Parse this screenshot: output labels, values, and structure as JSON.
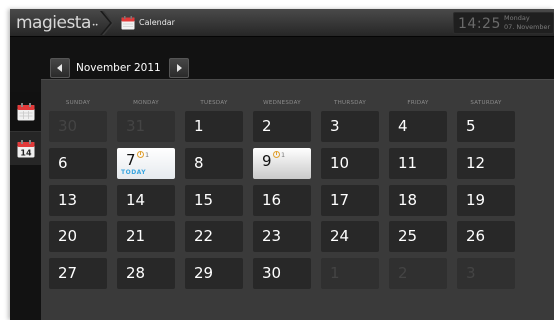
{
  "app": {
    "brand": "magiesta",
    "brand_mark": "••",
    "title": "Calendar",
    "accent_color": "#e23a3a",
    "today_color": "#3aa6e0"
  },
  "clock": {
    "time": "14:25",
    "weekday": "Monday",
    "date": "07. November"
  },
  "nav": {
    "month_label": "November 2011",
    "prev_icon": "chevron-left-icon",
    "next_icon": "chevron-right-icon"
  },
  "side_tabs": [
    {
      "name": "month-view",
      "icon": "calendar-icon",
      "label": ""
    },
    {
      "name": "day-view",
      "icon": "calendar-day-icon",
      "label": "14"
    }
  ],
  "weekdays": [
    "SUNDAY",
    "MONDAY",
    "TUESDAY",
    "WEDNESDAY",
    "THURSDAY",
    "FRIDAY",
    "SATURDAY"
  ],
  "today_label": "TODAY",
  "weeks": [
    [
      {
        "day": "30",
        "state": "muted"
      },
      {
        "day": "31",
        "state": "muted"
      },
      {
        "day": "1",
        "state": "normal"
      },
      {
        "day": "2",
        "state": "normal"
      },
      {
        "day": "3",
        "state": "normal"
      },
      {
        "day": "4",
        "state": "normal"
      },
      {
        "day": "5",
        "state": "normal"
      }
    ],
    [
      {
        "day": "6",
        "state": "normal"
      },
      {
        "day": "7",
        "state": "today",
        "events": "1"
      },
      {
        "day": "8",
        "state": "normal"
      },
      {
        "day": "9",
        "state": "event",
        "events": "1"
      },
      {
        "day": "10",
        "state": "normal"
      },
      {
        "day": "11",
        "state": "normal"
      },
      {
        "day": "12",
        "state": "normal"
      }
    ],
    [
      {
        "day": "13",
        "state": "normal"
      },
      {
        "day": "14",
        "state": "normal"
      },
      {
        "day": "15",
        "state": "normal"
      },
      {
        "day": "16",
        "state": "normal"
      },
      {
        "day": "17",
        "state": "normal"
      },
      {
        "day": "18",
        "state": "normal"
      },
      {
        "day": "19",
        "state": "normal"
      }
    ],
    [
      {
        "day": "20",
        "state": "normal"
      },
      {
        "day": "21",
        "state": "normal"
      },
      {
        "day": "22",
        "state": "normal"
      },
      {
        "day": "23",
        "state": "normal"
      },
      {
        "day": "24",
        "state": "normal"
      },
      {
        "day": "25",
        "state": "normal"
      },
      {
        "day": "26",
        "state": "normal"
      }
    ],
    [
      {
        "day": "27",
        "state": "normal"
      },
      {
        "day": "28",
        "state": "normal"
      },
      {
        "day": "29",
        "state": "normal"
      },
      {
        "day": "30",
        "state": "normal"
      },
      {
        "day": "1",
        "state": "muted"
      },
      {
        "day": "2",
        "state": "muted"
      },
      {
        "day": "3",
        "state": "muted"
      }
    ]
  ]
}
